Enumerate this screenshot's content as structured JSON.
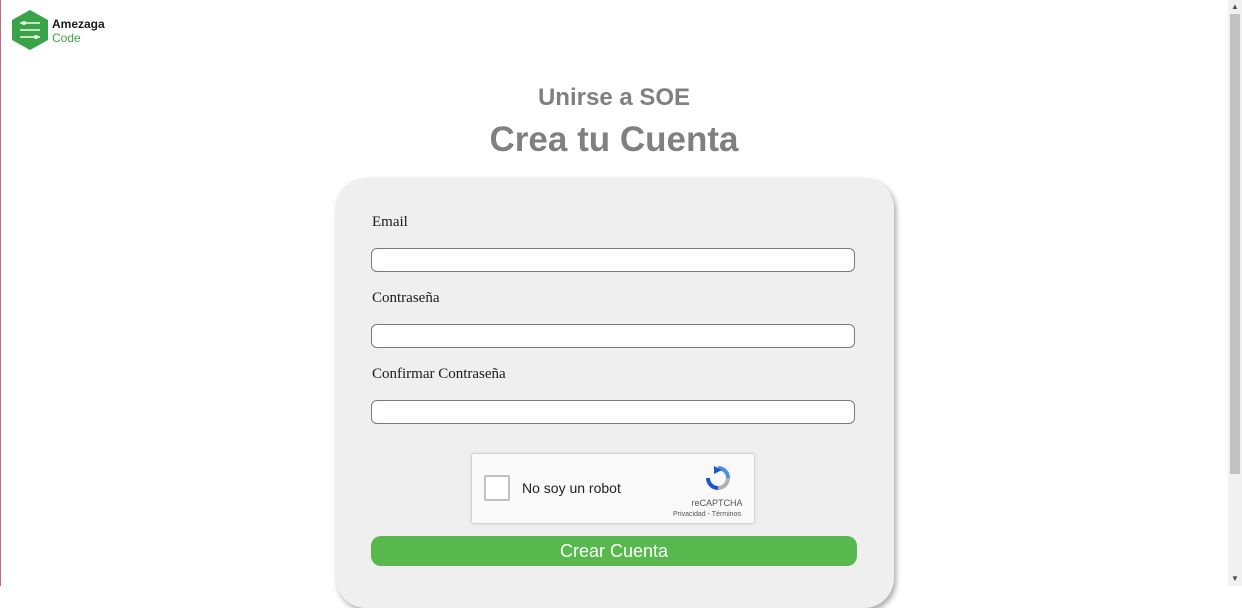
{
  "brand": {
    "name_line1": "Amezaga",
    "name_line2": "Code"
  },
  "header": {
    "subtitle": "Unirse a SOE",
    "title": "Crea tu Cuenta"
  },
  "form": {
    "email_label": "Email",
    "email_value": "",
    "password_label": "Contraseña",
    "password_value": "",
    "confirm_label": "Confirmar Contraseña",
    "confirm_value": "",
    "captcha": {
      "label": "No soy un robot",
      "brand": "reCAPTCHA",
      "links": "Privacidad - Términos",
      "checked": false
    },
    "submit_label": "Crear Cuenta"
  },
  "colors": {
    "accent": "#57b84d",
    "heading": "#808080",
    "card_bg": "#efefef",
    "logo_green": "#3aa34a"
  }
}
